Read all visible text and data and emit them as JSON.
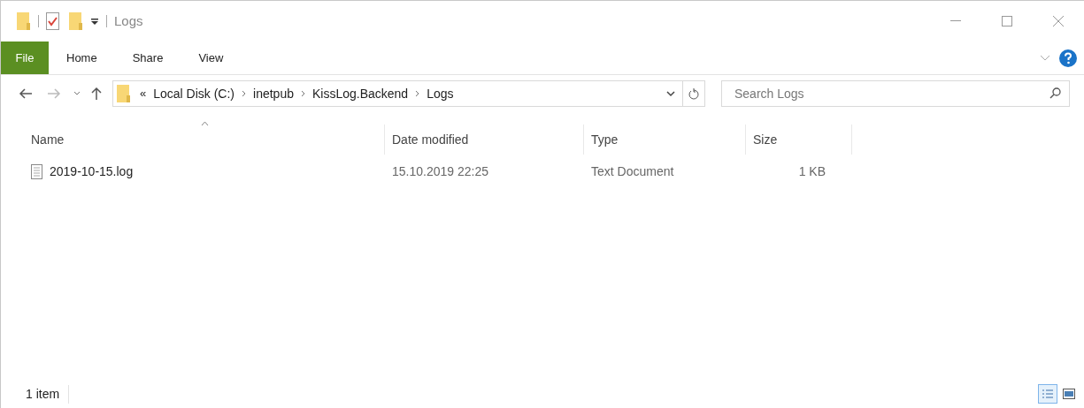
{
  "window": {
    "title": "Logs"
  },
  "ribbon_tabs": [
    {
      "label": "File",
      "kind": "menu"
    },
    {
      "label": "Home",
      "kind": "tab"
    },
    {
      "label": "Share",
      "kind": "tab"
    },
    {
      "label": "View",
      "kind": "tab"
    }
  ],
  "address_bar": {
    "overflow": "«",
    "crumbs": [
      "Local Disk (C:)",
      "inetpub",
      "KissLog.Backend",
      "Logs"
    ]
  },
  "search": {
    "placeholder": "Search Logs"
  },
  "table": {
    "columns": [
      {
        "label": "Name",
        "sorted": true
      },
      {
        "label": "Date modified",
        "sorted": false
      },
      {
        "label": "Type",
        "sorted": false
      },
      {
        "label": "Size",
        "sorted": false
      }
    ],
    "rows": [
      {
        "name": "2019-10-15.log",
        "date_modified": "15.10.2019 22:25",
        "type": "Text Document",
        "size": "1 KB"
      }
    ]
  },
  "status_bar": {
    "text": "1 item",
    "views": [
      {
        "kind": "details",
        "selected": true
      },
      {
        "kind": "large-icons",
        "selected": false
      }
    ]
  }
}
